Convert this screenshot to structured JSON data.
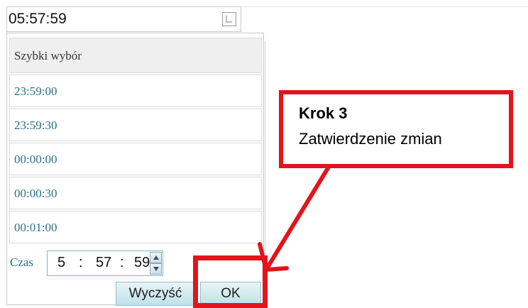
{
  "time_field": {
    "value": "05:57:59"
  },
  "quick_pick": {
    "header": "Szybki wybór",
    "items": [
      "23:59:00",
      "23:59:30",
      "00:00:00",
      "00:00:30",
      "00:01:00"
    ]
  },
  "time_input": {
    "label": "Czas",
    "hours": "5",
    "minutes": "57",
    "seconds": "59",
    "separator": ":"
  },
  "buttons": {
    "clear": "Wyczyść",
    "ok": "OK"
  },
  "annotation": {
    "title": "Krok 3",
    "text": "Zatwierdzenie zmian",
    "color": "#e3141b"
  },
  "icons": {
    "clock": "clock-icon",
    "spin_up": "chevron-up-icon",
    "spin_down": "chevron-down-icon"
  }
}
